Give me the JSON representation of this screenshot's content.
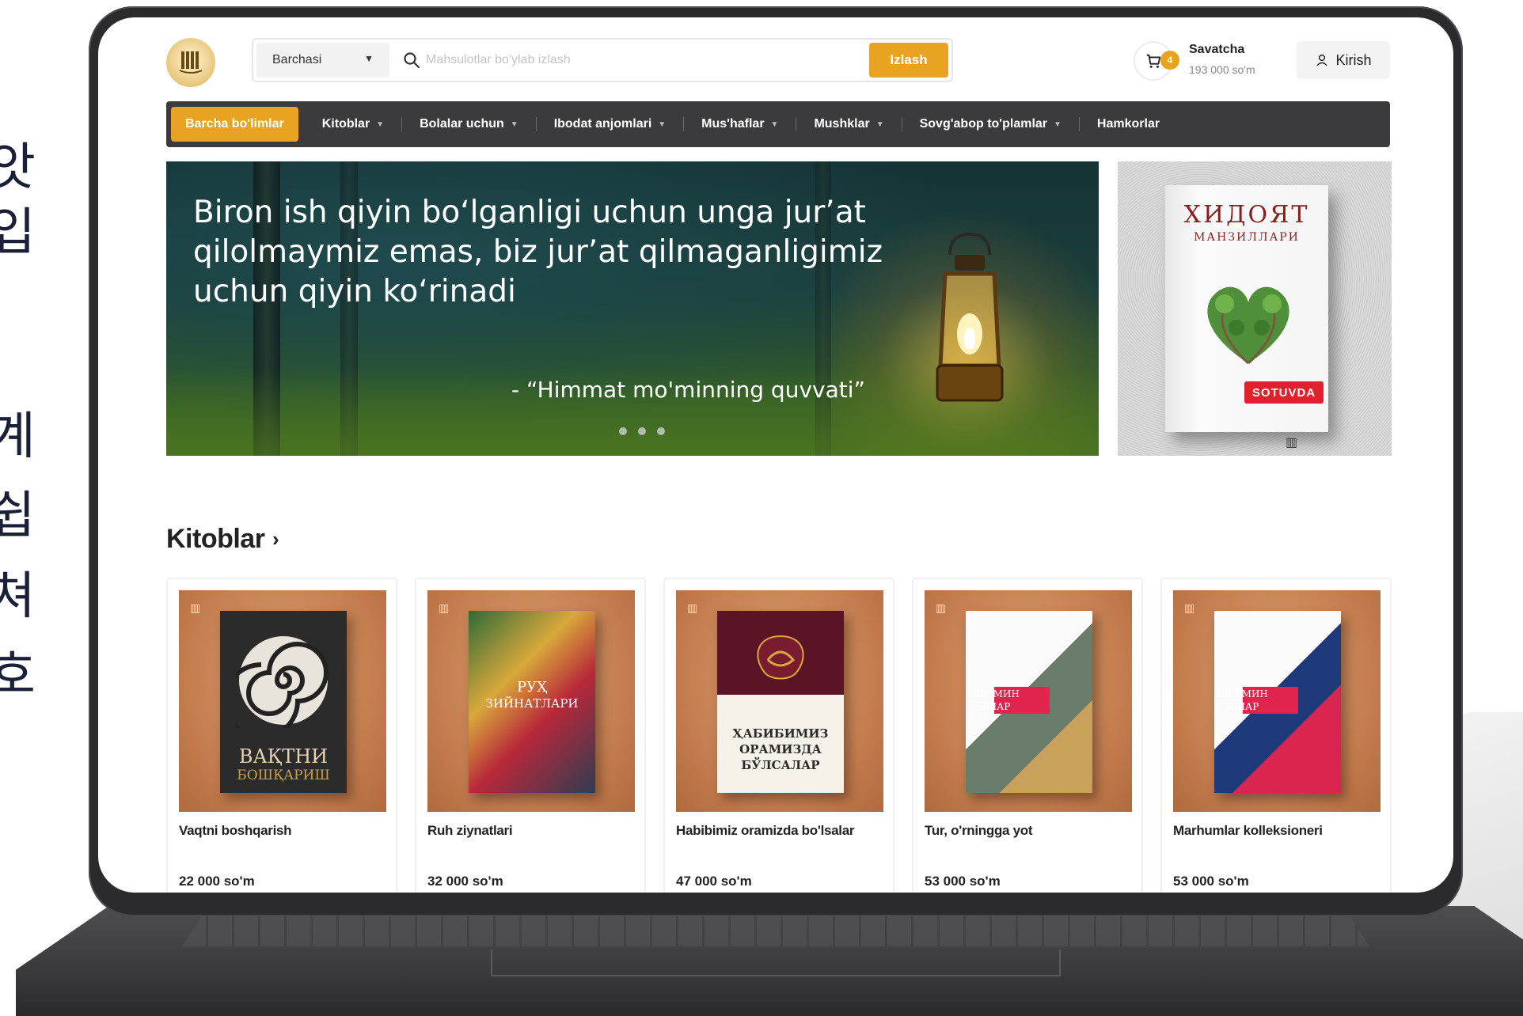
{
  "side_text": [
    "앗",
    "입",
    "계",
    "쉽",
    "쳐",
    "호"
  ],
  "header": {
    "logo_text": "",
    "category_select": "Barchasi",
    "search_placeholder": "Mahsulotlar bo'ylab izlash",
    "search_button": "Izlash",
    "cart_count": "4",
    "cart_title": "Savatcha",
    "cart_total": "193 000 so'm",
    "login_label": "Kirish"
  },
  "nav": {
    "items": [
      {
        "label": "Barcha bo'limlar",
        "active": true,
        "has_dropdown": false
      },
      {
        "label": "Kitoblar",
        "has_dropdown": true
      },
      {
        "label": "Bolalar uchun",
        "has_dropdown": true
      },
      {
        "label": "Ibodat anjomlari",
        "has_dropdown": true
      },
      {
        "label": "Mus'haflar",
        "has_dropdown": true
      },
      {
        "label": "Mushklar",
        "has_dropdown": true
      },
      {
        "label": "Sovg'abop to'plamlar",
        "has_dropdown": true
      },
      {
        "label": "Hamkorlar",
        "has_dropdown": false
      }
    ]
  },
  "hero": {
    "quote": "Biron ish qiyin bo‘lganligi uchun unga jur’at qilolmaymiz emas, biz jur’at qilmaganligimiz uchun qiyin ko‘rinadi",
    "author": "- “Himmat mo'minning quvvati”",
    "slide_count": 3
  },
  "promo": {
    "book_title": "ХИДОЯТ",
    "book_subtitle": "МАНЗИЛЛАРИ",
    "badge": "SOTUVDA"
  },
  "section": {
    "title": "Kitoblar",
    "products": [
      {
        "name": "Vaqtni boshqarish",
        "price": "22 000 so'm",
        "cover_lines": [
          "ВАҚТНИ",
          "БОШҚАРИШ"
        ]
      },
      {
        "name": "Ruh ziynatlari",
        "price": "32 000 so'm",
        "cover_lines": [
          "РУҲ",
          "ЗИЙНАТЛАРИ"
        ]
      },
      {
        "name": "Habibimiz oramizda bo'lsalar",
        "price": "47 000 so'm",
        "cover_lines": [
          "ҲАБИБИМИЗ",
          "ОРАМИЗДА",
          "БЎЛСАЛАР"
        ]
      },
      {
        "name": "Tur, o'rningga yot",
        "price": "53 000 so'm",
        "cover_lines": [
          "ШЕРМИН",
          "ЯШАР"
        ]
      },
      {
        "name": "Marhumlar kolleksioneri",
        "price": "53 000 so'm",
        "cover_lines": [
          "ШЕРМИН",
          "ЯШАР"
        ]
      }
    ]
  },
  "colors": {
    "accent": "#e7a321",
    "nav_bg": "#3b3b3d",
    "badge_red": "#e0202a"
  }
}
